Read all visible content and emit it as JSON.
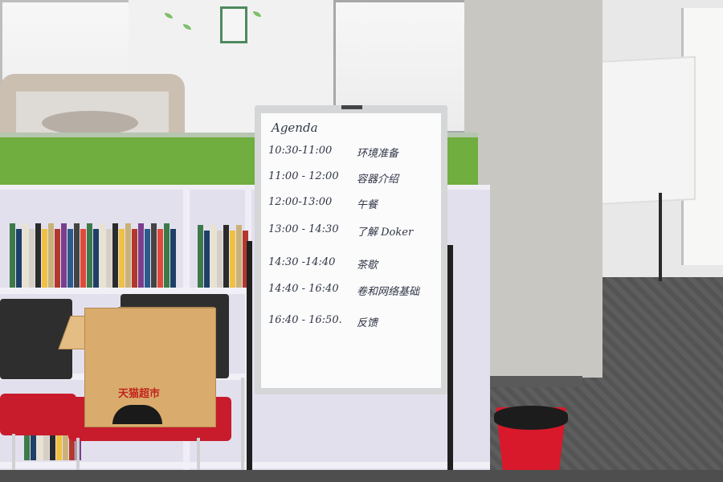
{
  "whiteboard": {
    "title": "Agenda",
    "items": [
      {
        "time": "10:30-11:00",
        "activity": "环境准备"
      },
      {
        "time": "11:00 - 12:00",
        "activity": "容器介绍"
      },
      {
        "time": "12:00-13:00",
        "activity": "午餐"
      },
      {
        "time": "13:00 - 14:30",
        "activity": "了解 Doker"
      },
      {
        "time": "14:30 -14:40",
        "activity": "茶歇"
      },
      {
        "time": "14:40 - 16:40",
        "activity": "卷和网络基础"
      },
      {
        "time": "16:40 - 16:50.",
        "activity": "反馈"
      }
    ]
  },
  "box": {
    "label": "天猫超市"
  },
  "colors": {
    "shelf_green": "#6fae3f",
    "chair_red": "#c81b2b",
    "bin_red": "#d8192b",
    "bookcase": "#e3e0ee"
  }
}
